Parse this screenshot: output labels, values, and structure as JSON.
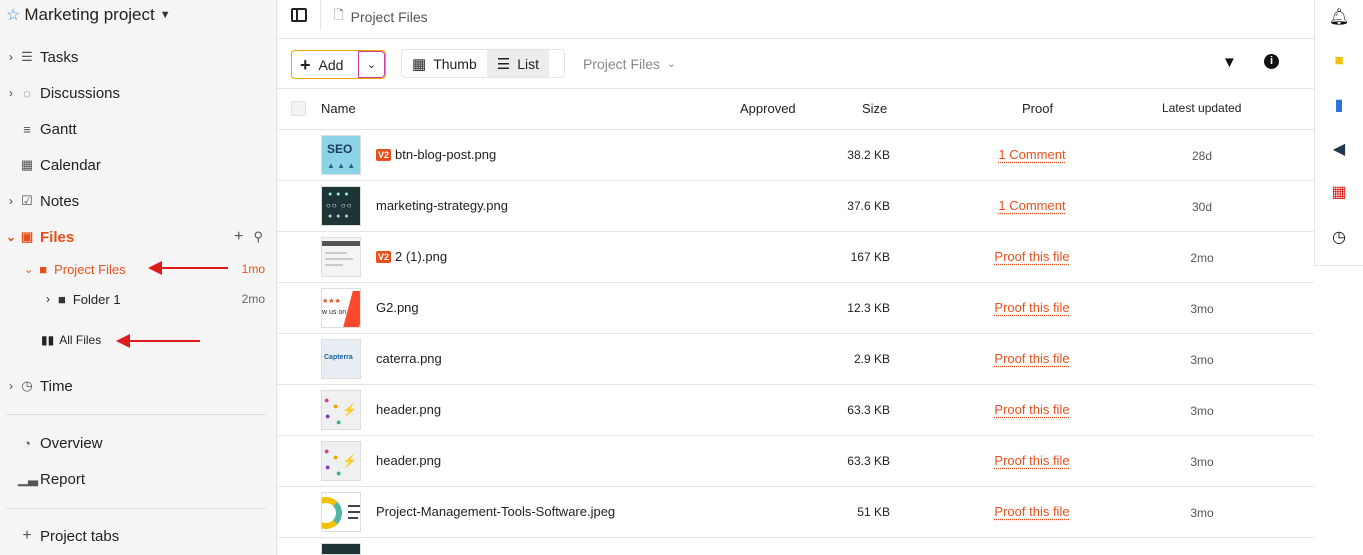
{
  "project": {
    "title": "Marketing project"
  },
  "nav": {
    "tasks": "Tasks",
    "discussions": "Discussions",
    "gantt": "Gantt",
    "calendar": "Calendar",
    "notes": "Notes",
    "files": "Files",
    "time": "Time",
    "overview": "Overview",
    "report": "Report",
    "project_tabs": "Project tabs"
  },
  "files_tree": {
    "project_files": {
      "label": "Project Files",
      "updated": "1mo"
    },
    "folder1": {
      "label": "Folder 1",
      "updated": "2mo"
    },
    "all_files": {
      "label": "All Files"
    }
  },
  "breadcrumb": {
    "current": "Project Files"
  },
  "toolbar": {
    "add_label": "Add",
    "thumb_label": "Thumb",
    "list_label": "List",
    "folder_select": "Project Files"
  },
  "table": {
    "headers": {
      "name": "Name",
      "approved": "Approved",
      "size": "Size",
      "proof": "Proof",
      "updated": "Latest updated"
    },
    "rows": [
      {
        "name": "btn-blog-post.png",
        "version": "V2",
        "size": "38.2 KB",
        "proof": "1 Comment",
        "updated": "28d"
      },
      {
        "name": "marketing-strategy.png",
        "version": "",
        "size": "37.6 KB",
        "proof": "1 Comment",
        "updated": "30d"
      },
      {
        "name": "2 (1).png",
        "version": "V2",
        "size": "167 KB",
        "proof": "Proof this file",
        "updated": "2mo"
      },
      {
        "name": "G2.png",
        "version": "",
        "size": "12.3 KB",
        "proof": "Proof this file",
        "updated": "3mo"
      },
      {
        "name": "caterra.png",
        "version": "",
        "size": "2.9 KB",
        "proof": "Proof this file",
        "updated": "3mo"
      },
      {
        "name": "header.png",
        "version": "",
        "size": "63.3 KB",
        "proof": "Proof this file",
        "updated": "3mo"
      },
      {
        "name": "header.png",
        "version": "",
        "size": "63.3 KB",
        "proof": "Proof this file",
        "updated": "3mo"
      },
      {
        "name": "Project-Management-Tools-Software.jpeg",
        "version": "",
        "size": "51 KB",
        "proof": "Proof this file",
        "updated": "3mo"
      }
    ]
  },
  "thumb_text": {
    "seo": "SEO",
    "capterra": "Capterra",
    "g2": "w us on"
  },
  "colors": {
    "accent": "#e8501b",
    "annotation_arrow": "#e01b1b"
  }
}
